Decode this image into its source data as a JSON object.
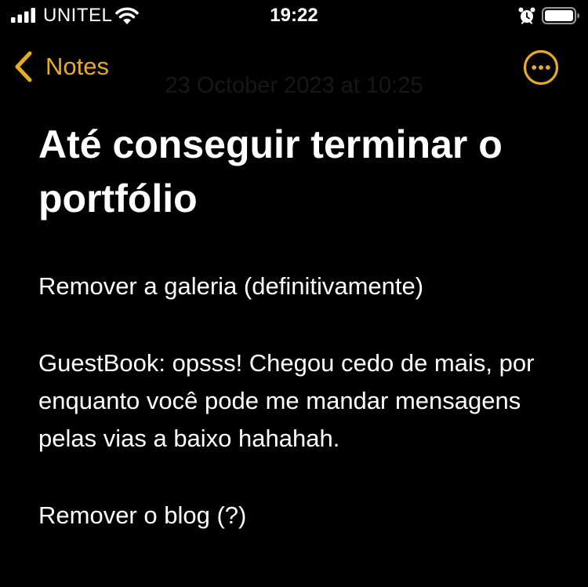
{
  "status_bar": {
    "carrier": "UNITEL",
    "time": "19:22",
    "icons": [
      "signal-icon",
      "wifi-icon",
      "alarm-icon",
      "battery-icon"
    ]
  },
  "nav": {
    "back_label": "Notes",
    "date": "23 October 2023 at 10:25",
    "more_icon": "ellipsis-circle-icon"
  },
  "note": {
    "title": "Até conseguir terminar o portfólio",
    "paragraphs": [
      "Remover a galeria (definitivamente)",
      "GuestBook: opsss! Chegou cedo de mais, por enquanto você pode me mandar mensagens pelas vias a baixo hahahah.",
      "Remover o blog (?)"
    ]
  },
  "colors": {
    "background": "#000000",
    "accent": "#E6AC24",
    "text": "#FFFFFF"
  }
}
